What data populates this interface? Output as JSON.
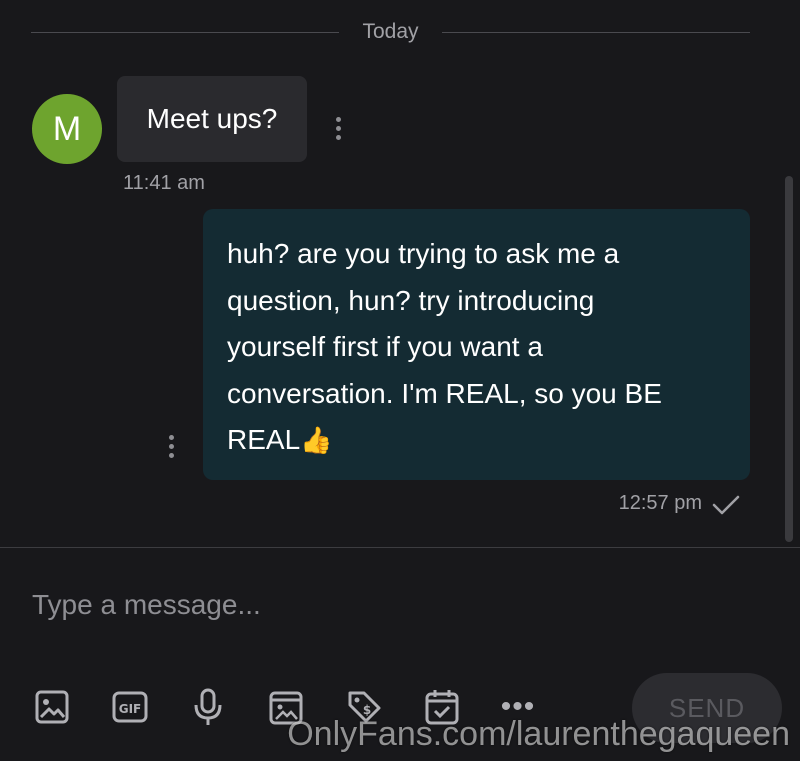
{
  "chat": {
    "date_divider": "Today",
    "messages": [
      {
        "direction": "incoming",
        "avatar_letter": "M",
        "text": "Meet ups?",
        "time": "11:41 am"
      },
      {
        "direction": "outgoing",
        "lines": [
          "huh? are you trying to ask me a",
          "question, hun? try introducing",
          "yourself first if you want a",
          "conversation. I'm REAL, so you BE",
          "REAL"
        ],
        "emoji": "👍",
        "time": "12:57 pm",
        "status": "sent"
      }
    ]
  },
  "composer": {
    "placeholder": "Type a message...",
    "toolbar": [
      "image-icon",
      "gif-icon",
      "microphone-icon",
      "media-vault-icon",
      "price-tag-icon",
      "schedule-icon",
      "more-icon"
    ],
    "send_label": "SEND"
  },
  "watermark": "OnlyFans.com/laurenthegaqueen",
  "colors": {
    "background": "#18181b",
    "incoming_bubble": "#2a2a2e",
    "outgoing_bubble": "#142b33",
    "avatar": "#6ea42e"
  }
}
